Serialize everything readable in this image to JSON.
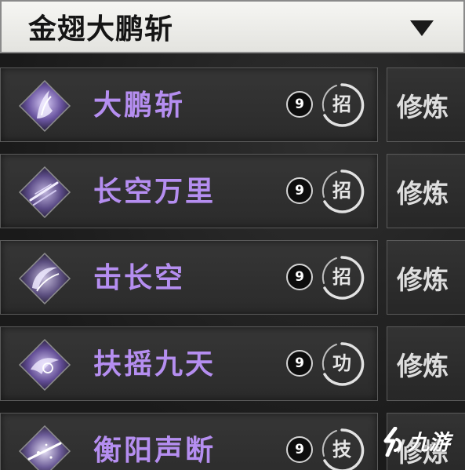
{
  "dropdown": {
    "title": "金翅大鹏斩"
  },
  "skills": [
    {
      "name": "大鹏斩",
      "level": "9",
      "type": "招",
      "action": "修炼"
    },
    {
      "name": "长空万里",
      "level": "9",
      "type": "招",
      "action": "修炼"
    },
    {
      "name": "击长空",
      "level": "9",
      "type": "招",
      "action": "修炼"
    },
    {
      "name": "扶摇九天",
      "level": "9",
      "type": "功",
      "action": "修炼"
    },
    {
      "name": "衡阳声断",
      "level": "9",
      "type": "技",
      "action": "修炼"
    }
  ],
  "watermark": {
    "text": "九游",
    "logo": "nine-game-logo"
  },
  "icons": {
    "dropdown": "triangle-down-icon",
    "skill": [
      "feather-flame-icon",
      "wind-slash-icon",
      "crescent-slash-icon",
      "vortex-wing-icon",
      "shatter-burst-icon"
    ]
  },
  "colors": {
    "skill_name": "#b58ef0",
    "panel": "#2f2f2f",
    "border": "#5a5a5a",
    "header_bg": "#eeeeea"
  }
}
